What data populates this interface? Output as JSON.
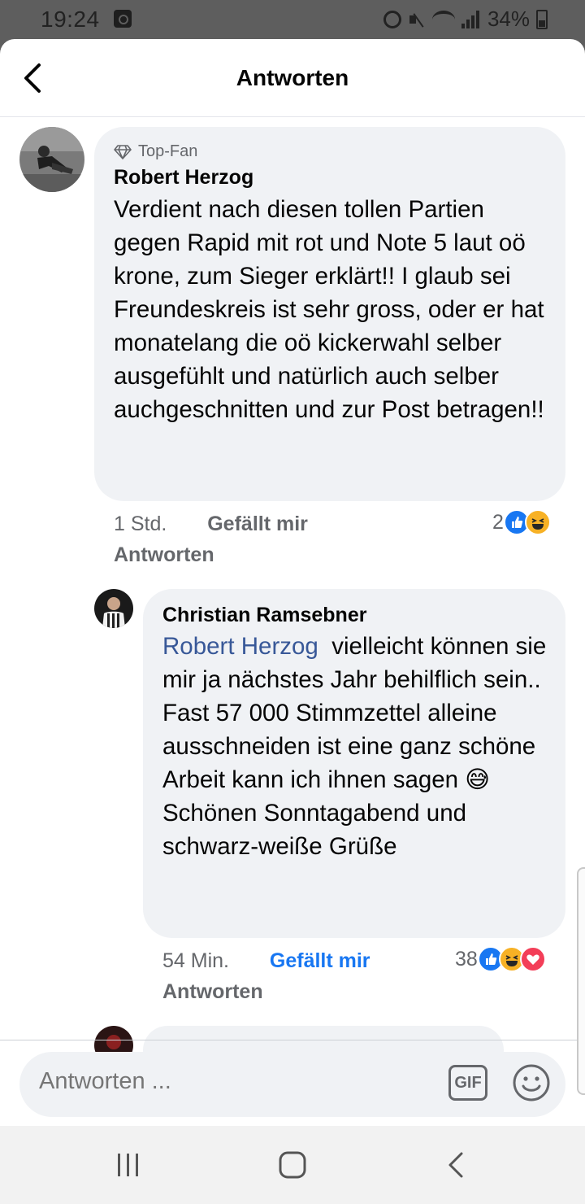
{
  "status_bar": {
    "time": "19:24",
    "battery": "34%"
  },
  "header": {
    "title": "Antworten"
  },
  "comments": [
    {
      "badge": "Top-Fan",
      "author": "Robert Herzog",
      "text": "Verdient nach diesen tollen Partien gegen Rapid mit rot und Note 5 laut oö krone, zum Sieger erklärt!! I glaub sei Freundeskreis ist sehr gross, oder er hat monatelang die oö kickerwahl selber ausgefühlt und natürlich auch selber auchgeschnitten und zur Post betragen!!",
      "time": "1 Std.",
      "like_label": "Gefällt mir",
      "reply_label": "Antworten",
      "reaction_count": "2"
    },
    {
      "author": "Christian Ramsebner",
      "mention": "Robert Herzog",
      "text": "vielleicht können sie mir ja nächstes Jahr behilflich sein.. Fast 57 000 Stimmzettel alleine ausschneiden ist eine ganz schöne Arbeit kann ich ihnen sagen 😅 Schönen Sonntagabend und schwarz-weiße Grüße",
      "time": "54 Min.",
      "like_label": "Gefällt mir",
      "reply_label": "Antworten",
      "reaction_count": "38"
    }
  ],
  "composer": {
    "placeholder": "Antworten ...",
    "gif_label": "GIF"
  },
  "colors": {
    "accent": "#1877f2",
    "bubble": "#f0f2f5",
    "meta_text": "#65676b"
  },
  "icons": {
    "back": "chevron-left-icon",
    "badge": "diamond-icon",
    "emoji": "smiley-icon",
    "nav_recent": "recent-apps-icon",
    "nav_home": "home-icon",
    "nav_back": "back-icon"
  }
}
